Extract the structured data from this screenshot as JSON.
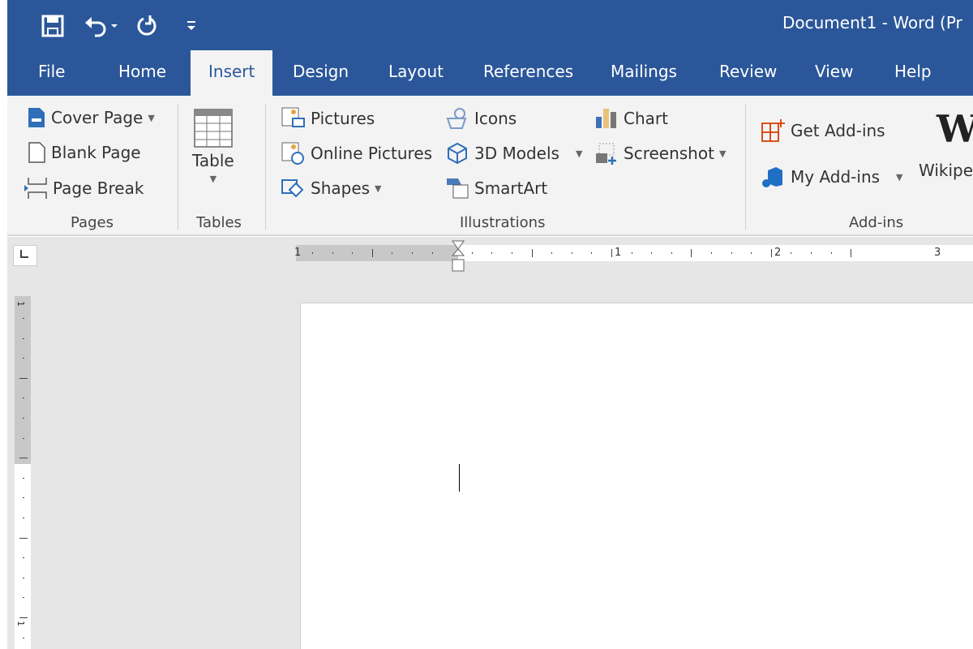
{
  "window": {
    "title": "Document1  -  Word (Pr"
  },
  "quick_access": [
    {
      "icon": "save-icon"
    },
    {
      "icon": "undo-icon"
    },
    {
      "icon": "redo-icon"
    },
    {
      "icon": "customize-icon"
    }
  ],
  "tabs": [
    {
      "label": "File"
    },
    {
      "label": "Home"
    },
    {
      "label": "Insert",
      "active": true
    },
    {
      "label": "Design"
    },
    {
      "label": "Layout"
    },
    {
      "label": "References"
    },
    {
      "label": "Mailings"
    },
    {
      "label": "Review"
    },
    {
      "label": "View"
    },
    {
      "label": "Help"
    }
  ],
  "ribbon": {
    "pages": {
      "label": "Pages",
      "items": [
        "Cover Page",
        "Blank Page",
        "Page Break"
      ]
    },
    "tables": {
      "label": "Tables",
      "items": [
        "Table"
      ]
    },
    "illustrations": {
      "label": "Illustrations",
      "items": [
        "Pictures",
        "Online Pictures",
        "Shapes",
        "Icons",
        "3D Models",
        "SmartArt",
        "Chart",
        "Screenshot"
      ]
    },
    "addins": {
      "label": "Add-ins",
      "items": [
        "Get Add-ins",
        "My Add-ins",
        "Wikipe"
      ],
      "wiki_logo": "W"
    }
  },
  "ruler": {
    "labels": [
      "1",
      "1",
      "2",
      "3"
    ]
  },
  "vruler": {
    "labels": [
      "1",
      "1"
    ]
  },
  "colors": {
    "accent": "#2b579a",
    "ribbon": "#f3f3f3",
    "workspace": "#e6e6e6"
  }
}
